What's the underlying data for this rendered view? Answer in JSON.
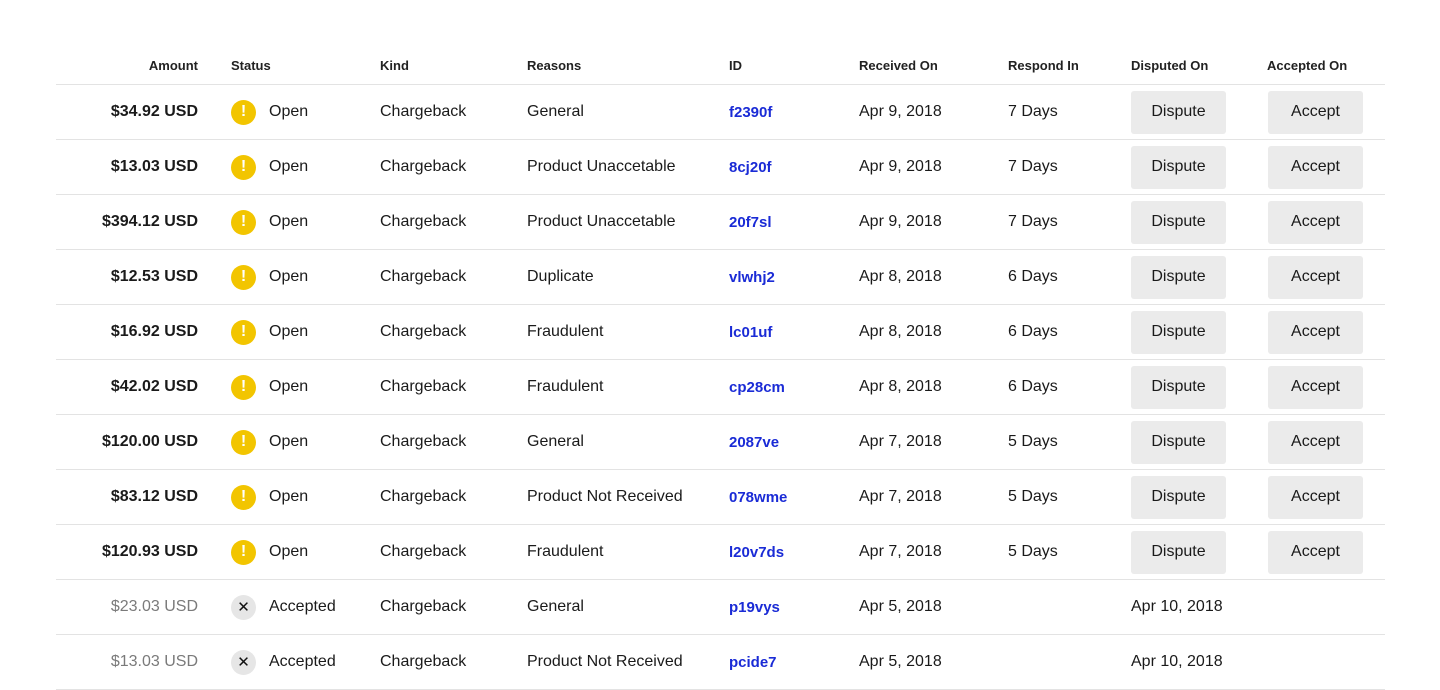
{
  "columns": {
    "amount": "Amount",
    "status": "Status",
    "kind": "Kind",
    "reasons": "Reasons",
    "id": "ID",
    "received_on": "Received On",
    "respond_in": "Respond In",
    "disputed_on": "Disputed On",
    "accepted_on": "Accepted On"
  },
  "actions": {
    "dispute_label": "Dispute",
    "accept_label": "Accept"
  },
  "colors": {
    "open_status": "#f2c500",
    "accepted_status": "#e6e6e6",
    "link": "#1a2bd6",
    "button_bg": "#ebebeb"
  },
  "rows": [
    {
      "amount": "$34.92 USD",
      "status": "Open",
      "status_type": "open",
      "status_icon": "exclamation-icon",
      "kind": "Chargeback",
      "reason": "General",
      "id": "f2390f",
      "received_on": "Apr 9, 2018",
      "respond_in": "7 Days",
      "disputed_on": "",
      "accepted_on": ""
    },
    {
      "amount": "$13.03 USD",
      "status": "Open",
      "status_type": "open",
      "status_icon": "exclamation-icon",
      "kind": "Chargeback",
      "reason": "Product Unaccetable",
      "id": "8cj20f",
      "received_on": "Apr 9, 2018",
      "respond_in": "7 Days",
      "disputed_on": "",
      "accepted_on": ""
    },
    {
      "amount": "$394.12 USD",
      "status": "Open",
      "status_type": "open",
      "status_icon": "exclamation-icon",
      "kind": "Chargeback",
      "reason": "Product Unaccetable",
      "id": "20f7sl",
      "received_on": "Apr 9, 2018",
      "respond_in": "7 Days",
      "disputed_on": "",
      "accepted_on": ""
    },
    {
      "amount": "$12.53 USD",
      "status": "Open",
      "status_type": "open",
      "status_icon": "exclamation-icon",
      "kind": "Chargeback",
      "reason": "Duplicate",
      "id": "vlwhj2",
      "received_on": "Apr 8, 2018",
      "respond_in": "6 Days",
      "disputed_on": "",
      "accepted_on": ""
    },
    {
      "amount": "$16.92 USD",
      "status": "Open",
      "status_type": "open",
      "status_icon": "exclamation-icon",
      "kind": "Chargeback",
      "reason": "Fraudulent",
      "id": "lc01uf",
      "received_on": "Apr 8, 2018",
      "respond_in": "6 Days",
      "disputed_on": "",
      "accepted_on": ""
    },
    {
      "amount": "$42.02 USD",
      "status": "Open",
      "status_type": "open",
      "status_icon": "exclamation-icon",
      "kind": "Chargeback",
      "reason": "Fraudulent",
      "id": "cp28cm",
      "received_on": "Apr 8, 2018",
      "respond_in": "6 Days",
      "disputed_on": "",
      "accepted_on": ""
    },
    {
      "amount": "$120.00 USD",
      "status": "Open",
      "status_type": "open",
      "status_icon": "exclamation-icon",
      "kind": "Chargeback",
      "reason": "General",
      "id": "2087ve",
      "received_on": "Apr 7, 2018",
      "respond_in": "5 Days",
      "disputed_on": "",
      "accepted_on": ""
    },
    {
      "amount": "$83.12 USD",
      "status": "Open",
      "status_type": "open",
      "status_icon": "exclamation-icon",
      "kind": "Chargeback",
      "reason": "Product Not Received",
      "id": "078wme",
      "received_on": "Apr 7, 2018",
      "respond_in": "5 Days",
      "disputed_on": "",
      "accepted_on": ""
    },
    {
      "amount": "$120.93 USD",
      "status": "Open",
      "status_type": "open",
      "status_icon": "exclamation-icon",
      "kind": "Chargeback",
      "reason": "Fraudulent",
      "id": "l20v7ds",
      "received_on": "Apr 7, 2018",
      "respond_in": "5 Days",
      "disputed_on": "",
      "accepted_on": ""
    },
    {
      "amount": "$23.03 USD",
      "status": "Accepted",
      "status_type": "accepted",
      "status_icon": "close-icon",
      "kind": "Chargeback",
      "reason": "General",
      "id": "p19vys",
      "received_on": "Apr 5, 2018",
      "respond_in": "",
      "disputed_on": "Apr 10, 2018",
      "accepted_on": ""
    },
    {
      "amount": "$13.03 USD",
      "status": "Accepted",
      "status_type": "accepted",
      "status_icon": "close-icon",
      "kind": "Chargeback",
      "reason": "Product Not Received",
      "id": "pcide7",
      "received_on": "Apr 5, 2018",
      "respond_in": "",
      "disputed_on": "Apr 10, 2018",
      "accepted_on": ""
    }
  ]
}
